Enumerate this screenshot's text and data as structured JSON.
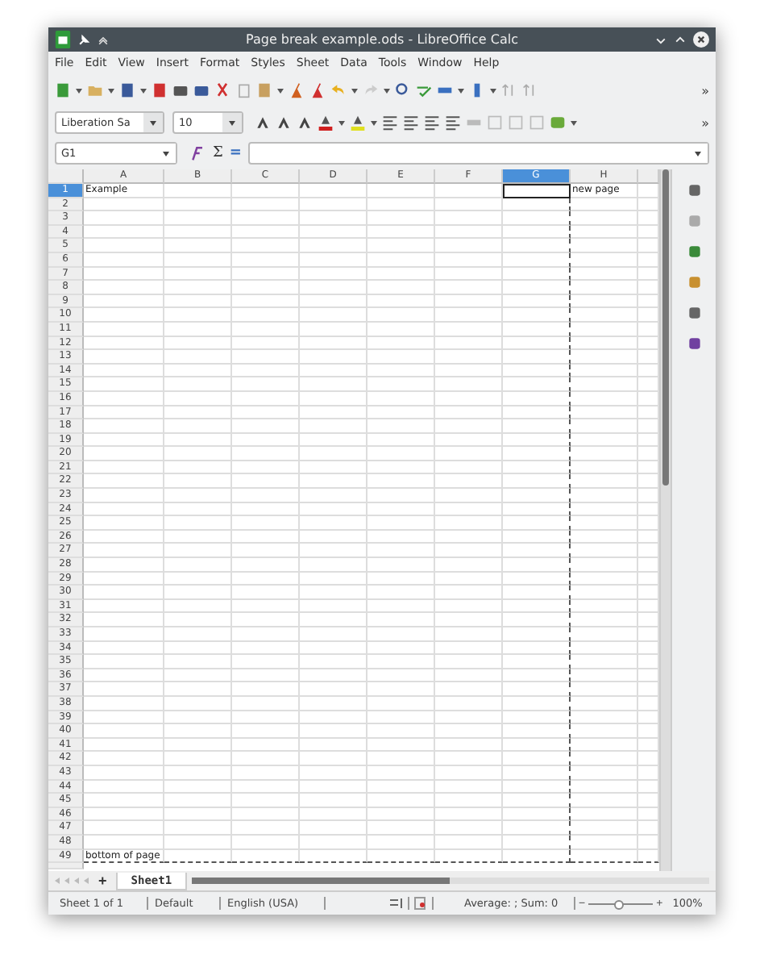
{
  "window": {
    "title": "Page break example.ods - LibreOffice Calc"
  },
  "menu": [
    "File",
    "Edit",
    "View",
    "Insert",
    "Format",
    "Styles",
    "Sheet",
    "Data",
    "Tools",
    "Window",
    "Help"
  ],
  "toolbar": {
    "overflow": "»"
  },
  "format_bar": {
    "font_name": "Liberation Sa",
    "font_size": "10",
    "overflow": "»"
  },
  "formula_bar": {
    "name_box": "G1",
    "sum_symbol": "Σ",
    "equals_symbol": "="
  },
  "columns": [
    {
      "label": "A",
      "selected": false,
      "page_break": false
    },
    {
      "label": "B",
      "selected": false,
      "page_break": false
    },
    {
      "label": "C",
      "selected": false,
      "page_break": false
    },
    {
      "label": "D",
      "selected": false,
      "page_break": false
    },
    {
      "label": "E",
      "selected": false,
      "page_break": false
    },
    {
      "label": "F",
      "selected": false,
      "page_break": false
    },
    {
      "label": "G",
      "selected": true,
      "page_break": true
    },
    {
      "label": "H",
      "selected": false,
      "page_break": false
    }
  ],
  "rows": [
    {
      "label": "1",
      "selected": true,
      "page_break": false,
      "cells": {
        "0": "Example",
        "7": "new page"
      }
    },
    {
      "label": "2",
      "selected": false,
      "page_break": false
    },
    {
      "label": "3",
      "selected": false,
      "page_break": false
    },
    {
      "label": "4",
      "selected": false,
      "page_break": false
    },
    {
      "label": "5",
      "selected": false,
      "page_break": false
    },
    {
      "label": "6",
      "selected": false,
      "page_break": false
    },
    {
      "label": "7",
      "selected": false,
      "page_break": false
    },
    {
      "label": "8",
      "selected": false,
      "page_break": false
    },
    {
      "label": "9",
      "selected": false,
      "page_break": false
    },
    {
      "label": "10",
      "selected": false,
      "page_break": false
    },
    {
      "label": "11",
      "selected": false,
      "page_break": false
    },
    {
      "label": "12",
      "selected": false,
      "page_break": false
    },
    {
      "label": "13",
      "selected": false,
      "page_break": false
    },
    {
      "label": "14",
      "selected": false,
      "page_break": false
    },
    {
      "label": "15",
      "selected": false,
      "page_break": false
    },
    {
      "label": "16",
      "selected": false,
      "page_break": false
    },
    {
      "label": "17",
      "selected": false,
      "page_break": false
    },
    {
      "label": "18",
      "selected": false,
      "page_break": false
    },
    {
      "label": "19",
      "selected": false,
      "page_break": false
    },
    {
      "label": "20",
      "selected": false,
      "page_break": false
    },
    {
      "label": "21",
      "selected": false,
      "page_break": false
    },
    {
      "label": "22",
      "selected": false,
      "page_break": false
    },
    {
      "label": "23",
      "selected": false,
      "page_break": false
    },
    {
      "label": "24",
      "selected": false,
      "page_break": false
    },
    {
      "label": "25",
      "selected": false,
      "page_break": false
    },
    {
      "label": "26",
      "selected": false,
      "page_break": false
    },
    {
      "label": "27",
      "selected": false,
      "page_break": false
    },
    {
      "label": "28",
      "selected": false,
      "page_break": false
    },
    {
      "label": "29",
      "selected": false,
      "page_break": false
    },
    {
      "label": "30",
      "selected": false,
      "page_break": false
    },
    {
      "label": "31",
      "selected": false,
      "page_break": false
    },
    {
      "label": "32",
      "selected": false,
      "page_break": false
    },
    {
      "label": "33",
      "selected": false,
      "page_break": false
    },
    {
      "label": "34",
      "selected": false,
      "page_break": false
    },
    {
      "label": "35",
      "selected": false,
      "page_break": false
    },
    {
      "label": "36",
      "selected": false,
      "page_break": false
    },
    {
      "label": "37",
      "selected": false,
      "page_break": false
    },
    {
      "label": "38",
      "selected": false,
      "page_break": false
    },
    {
      "label": "39",
      "selected": false,
      "page_break": false
    },
    {
      "label": "40",
      "selected": false,
      "page_break": false
    },
    {
      "label": "41",
      "selected": false,
      "page_break": false
    },
    {
      "label": "42",
      "selected": false,
      "page_break": false
    },
    {
      "label": "43",
      "selected": false,
      "page_break": false
    },
    {
      "label": "44",
      "selected": false,
      "page_break": false
    },
    {
      "label": "45",
      "selected": false,
      "page_break": false
    },
    {
      "label": "46",
      "selected": false,
      "page_break": false
    },
    {
      "label": "47",
      "selected": false,
      "page_break": false
    },
    {
      "label": "48",
      "selected": false,
      "page_break": false
    },
    {
      "label": "49",
      "selected": false,
      "page_break": true,
      "cells": {
        "0": "bottom of page"
      }
    }
  ],
  "sheet_tabs": {
    "add": "+",
    "tabs": [
      {
        "label": "Sheet1",
        "selected": true
      }
    ]
  },
  "status_bar": {
    "sheet": "Sheet 1 of 1",
    "page_style": "Default",
    "language": "English (USA)",
    "summary": "Average: ; Sum: 0",
    "zoom_minus": "−",
    "zoom_slider": {
      "level": 0.45
    },
    "zoom_plus": "+",
    "zoom": "100%"
  }
}
